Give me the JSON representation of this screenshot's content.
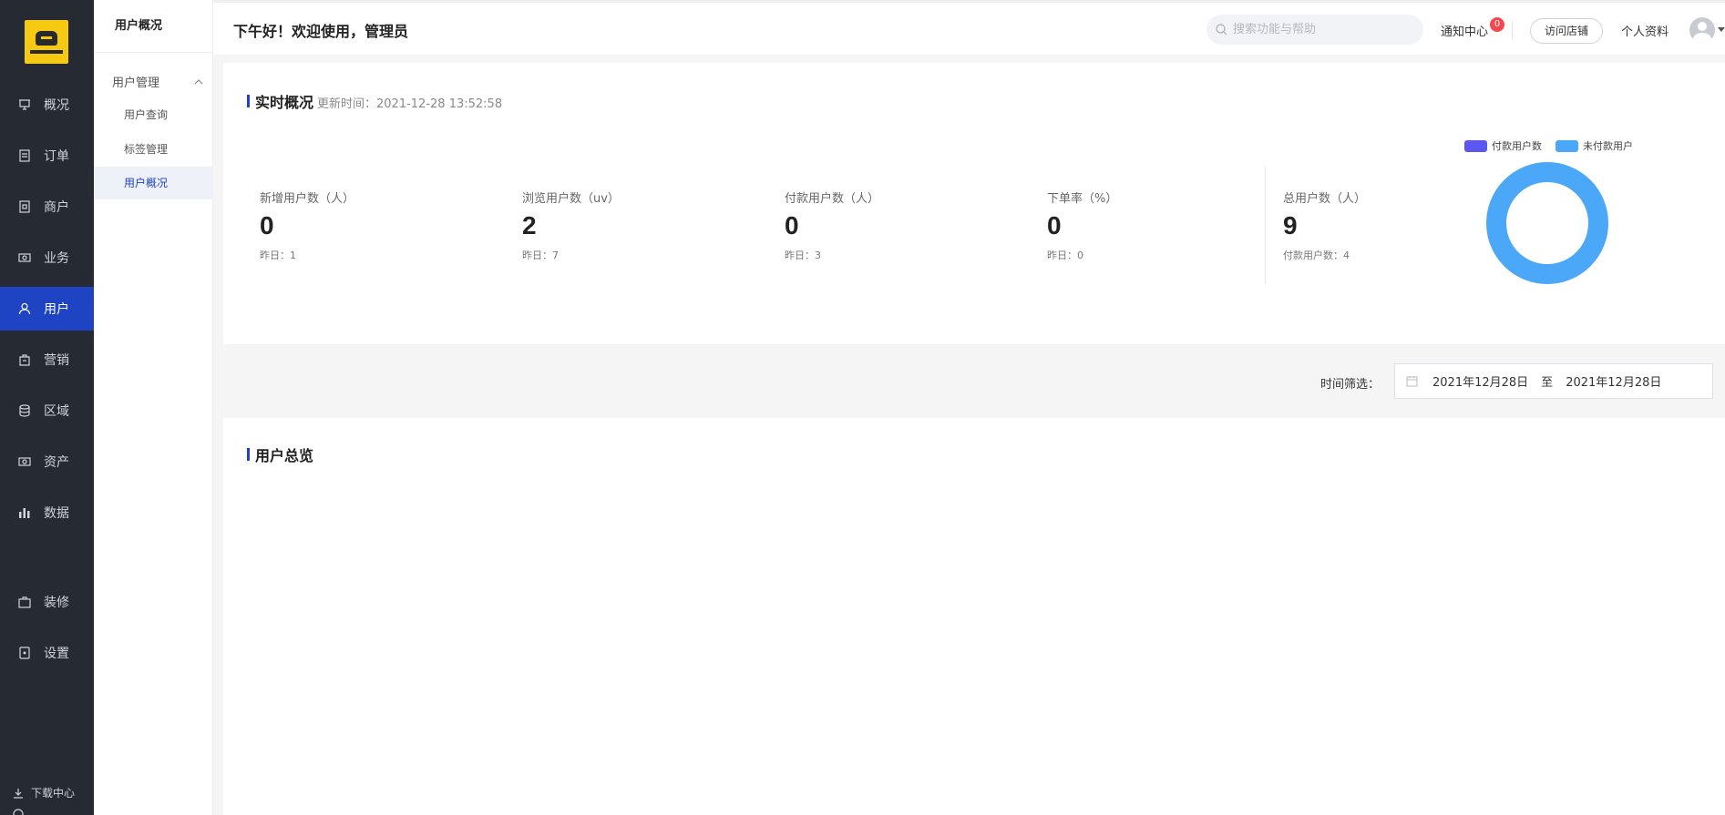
{
  "nav": {
    "items": [
      {
        "label": "概况",
        "icon": "presentation-icon"
      },
      {
        "label": "订单",
        "icon": "document-icon"
      },
      {
        "label": "商户",
        "icon": "store-icon"
      },
      {
        "label": "业务",
        "icon": "money-icon"
      },
      {
        "label": "用户",
        "icon": "user-icon",
        "active": true
      },
      {
        "label": "营销",
        "icon": "shopping-bag-icon"
      },
      {
        "label": "区域",
        "icon": "database-icon"
      },
      {
        "label": "资产",
        "icon": "wallet-icon"
      },
      {
        "label": "数据",
        "icon": "bar-chart-icon"
      },
      {
        "label": "装修",
        "icon": "briefcase-icon"
      },
      {
        "label": "设置",
        "icon": "settings-icon"
      }
    ],
    "download_center": "下载中心"
  },
  "subnav": {
    "title": "用户概况",
    "group": "用户管理",
    "links": [
      {
        "label": "用户查询"
      },
      {
        "label": "标签管理"
      },
      {
        "label": "用户概况",
        "active": true
      }
    ]
  },
  "topbar": {
    "greeting": "下午好！欢迎使用，管理员",
    "search_placeholder": "搜索功能与帮助",
    "notice_label": "通知中心",
    "notice_count": "0",
    "visit_store": "访问店铺",
    "profile": "个人资料"
  },
  "realtime": {
    "title": "实时概况",
    "updated": "更新时间：2021-12-28 13:52:58",
    "stats": [
      {
        "label": "新增用户数（人）",
        "value": "0",
        "yesterday": "昨日：1"
      },
      {
        "label": "浏览用户数（uv）",
        "value": "2",
        "yesterday": "昨日：7"
      },
      {
        "label": "付款用户数（人）",
        "value": "0",
        "yesterday": "昨日：3"
      },
      {
        "label": "下单率（%）",
        "value": "0",
        "yesterday": "昨日：0"
      },
      {
        "label": "总用户数（人）",
        "value": "9",
        "yesterday": "付款用户数：4"
      }
    ]
  },
  "chart_data": {
    "type": "pie",
    "categories": [
      "付款用户数",
      "未付款用户"
    ],
    "values": [
      0,
      9
    ],
    "colors": [
      "#5b57f0",
      "#4ba7f7"
    ],
    "legend": "top"
  },
  "filter": {
    "label": "时间筛选：",
    "start": "2021年12月28日",
    "to": "至",
    "end": "2021年12月28日"
  },
  "overview": {
    "title": "用户总览"
  }
}
